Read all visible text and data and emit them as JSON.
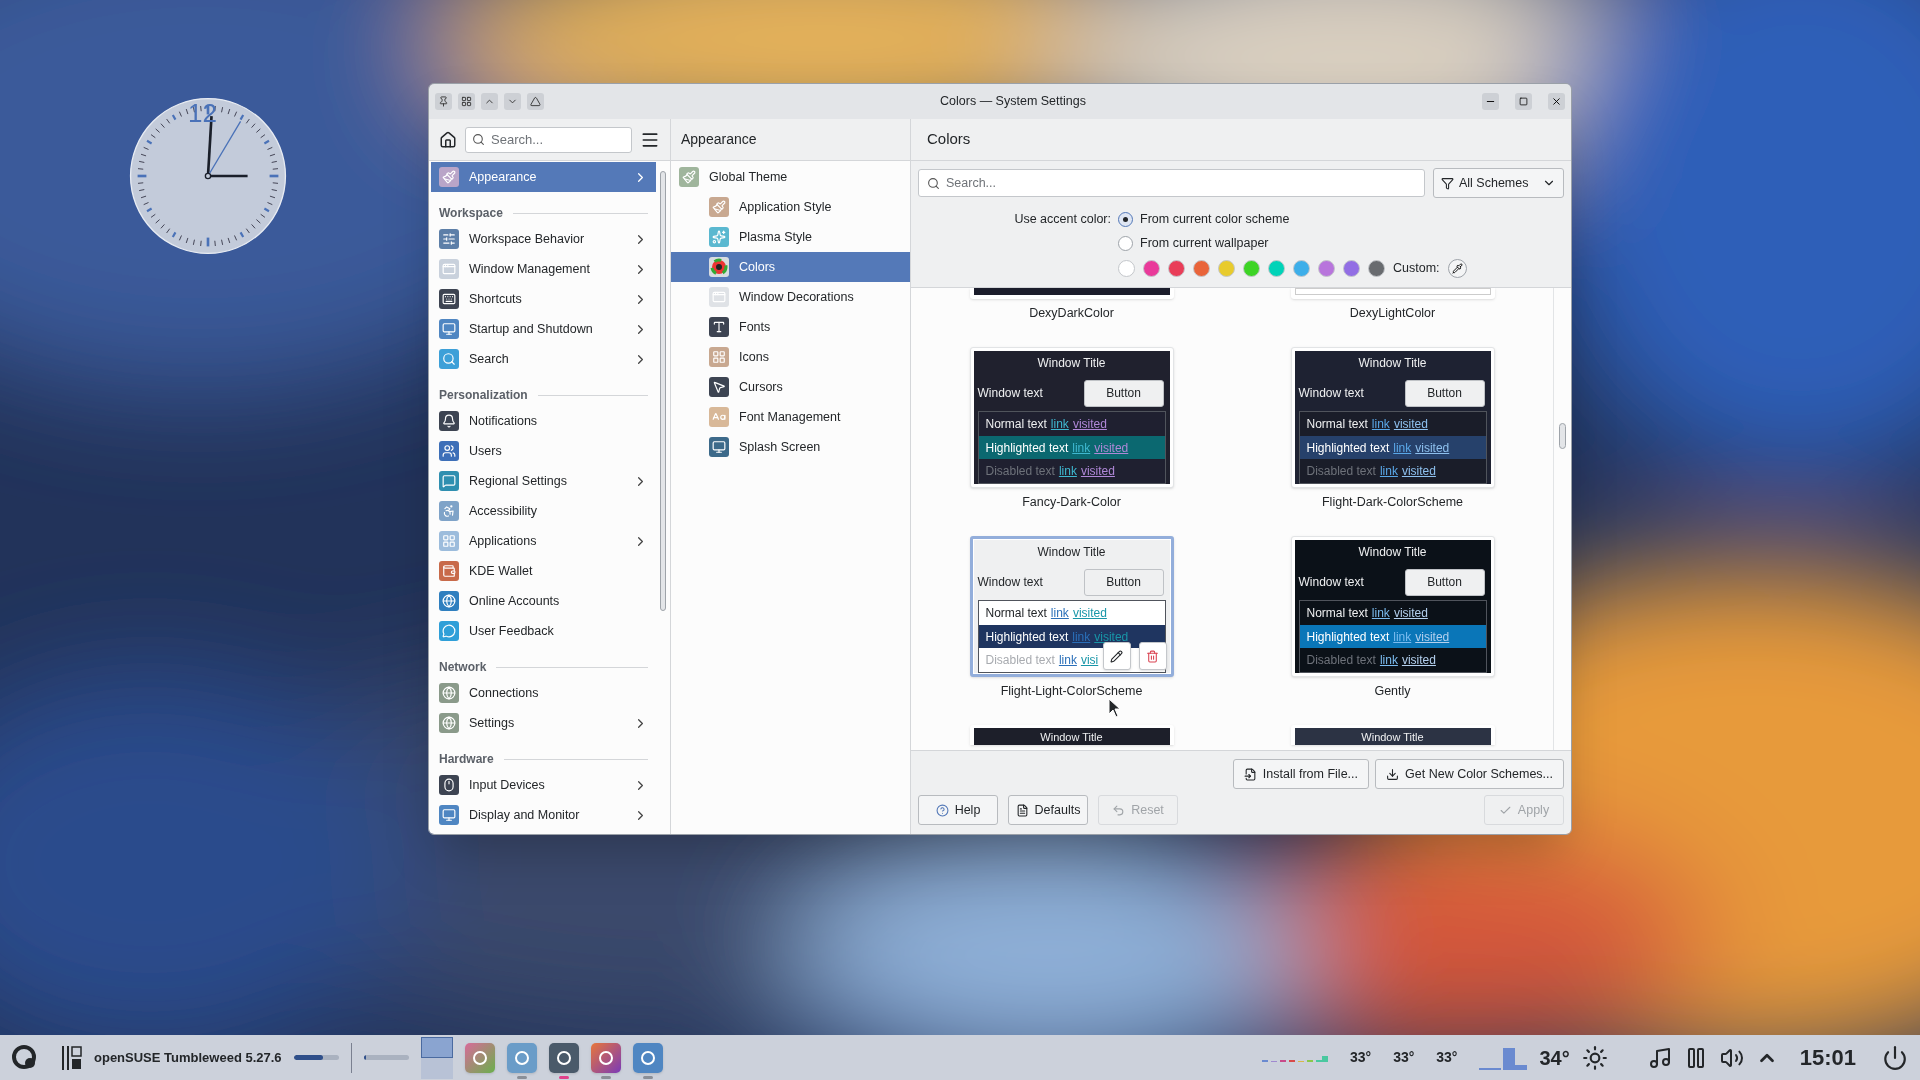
{
  "window": {
    "title": "Colors — System Settings"
  },
  "clock": {
    "numeral": "12"
  },
  "sidebar": {
    "search": {
      "placeholder": "Search..."
    },
    "items": [
      {
        "kind": "item",
        "label": "Appearance",
        "selected": true,
        "expandable": true
      },
      {
        "kind": "section",
        "label": "Workspace"
      },
      {
        "kind": "item",
        "label": "Workspace Behavior",
        "selected": false,
        "expandable": true
      },
      {
        "kind": "item",
        "label": "Window Management",
        "selected": false,
        "expandable": true
      },
      {
        "kind": "item",
        "label": "Shortcuts",
        "selected": false,
        "expandable": true
      },
      {
        "kind": "item",
        "label": "Startup and Shutdown",
        "selected": false,
        "expandable": true
      },
      {
        "kind": "item",
        "label": "Search",
        "selected": false,
        "expandable": true
      },
      {
        "kind": "section",
        "label": "Personalization"
      },
      {
        "kind": "item",
        "label": "Notifications",
        "selected": false,
        "expandable": false
      },
      {
        "kind": "item",
        "label": "Users",
        "selected": false,
        "expandable": false
      },
      {
        "kind": "item",
        "label": "Regional Settings",
        "selected": false,
        "expandable": true
      },
      {
        "kind": "item",
        "label": "Accessibility",
        "selected": false,
        "expandable": false
      },
      {
        "kind": "item",
        "label": "Applications",
        "selected": false,
        "expandable": true
      },
      {
        "kind": "item",
        "label": "KDE Wallet",
        "selected": false,
        "expandable": false
      },
      {
        "kind": "item",
        "label": "Online Accounts",
        "selected": false,
        "expandable": false
      },
      {
        "kind": "item",
        "label": "User Feedback",
        "selected": false,
        "expandable": false
      },
      {
        "kind": "section",
        "label": "Network"
      },
      {
        "kind": "item",
        "label": "Connections",
        "selected": false,
        "expandable": false
      },
      {
        "kind": "item",
        "label": "Settings",
        "selected": false,
        "expandable": true
      },
      {
        "kind": "section",
        "label": "Hardware"
      },
      {
        "kind": "item",
        "label": "Input Devices",
        "selected": false,
        "expandable": true
      },
      {
        "kind": "item",
        "label": "Display and Monitor",
        "selected": false,
        "expandable": true
      }
    ]
  },
  "subpanel": {
    "title": "Appearance",
    "items": [
      {
        "label": "Global Theme",
        "selected": false,
        "children": [
          {
            "label": "Application Style",
            "selected": false
          },
          {
            "label": "Plasma Style",
            "selected": false
          },
          {
            "label": "Colors",
            "selected": true
          },
          {
            "label": "Window Decorations",
            "selected": false
          },
          {
            "label": "Fonts",
            "selected": false
          },
          {
            "label": "Icons",
            "selected": false
          },
          {
            "label": "Cursors",
            "selected": false
          },
          {
            "label": "Font Management",
            "selected": false
          },
          {
            "label": "Splash Screen",
            "selected": false
          }
        ]
      }
    ]
  },
  "content": {
    "title": "Colors",
    "search": {
      "placeholder": "Search..."
    },
    "filter": "All Schemes",
    "accent": {
      "label": "Use accent color:",
      "options": [
        {
          "label": "From current color scheme",
          "selected": true
        },
        {
          "label": "From current wallpaper",
          "selected": false
        }
      ],
      "swatches": [
        {
          "color": "#ffffff"
        },
        {
          "color": "#e93a9a"
        },
        {
          "color": "#e93d58"
        },
        {
          "color": "#e9643a"
        },
        {
          "color": "#e8cb2d"
        },
        {
          "color": "#3dd425"
        },
        {
          "color": "#00d3b8"
        },
        {
          "color": "#3daee9"
        },
        {
          "color": "#b875dc"
        },
        {
          "color": "#926ee4"
        },
        {
          "color": "#686b6f"
        }
      ],
      "custom_label": "Custom:"
    },
    "schemes": [
      {
        "kind": "strip",
        "name": "DexyDarkColor",
        "selected": false,
        "dark": true,
        "color": "#1b1d2b"
      },
      {
        "kind": "strip",
        "name": "DexyLightColor",
        "selected": false,
        "dark": false,
        "color": "#ffffff"
      },
      {
        "kind": "full",
        "name": "Fancy-Dark-Color",
        "selected": false,
        "dark": true,
        "color": "#20212e",
        "palette": [
          {
            "kind": "view",
            "color": "#1f2030"
          },
          {
            "kind": "highlight",
            "color": "#0b6870"
          },
          {
            "kind": "link",
            "color": "#3fb8d0"
          },
          {
            "kind": "visited",
            "color": "#b088d8"
          }
        ],
        "preview": {
          "title": "Window Title",
          "window_text": "Window text",
          "button": "Button",
          "rows": [
            {
              "kind": "normal",
              "text": "Normal text",
              "link": "link",
              "visited": "visited"
            },
            {
              "kind": "highlighted",
              "text": "Highlighted text",
              "link": "link",
              "visited": "visited"
            },
            {
              "kind": "disabled",
              "text": "Disabled text",
              "link": "link",
              "visited": "visited"
            }
          ]
        }
      },
      {
        "kind": "full",
        "name": "Flight-Dark-ColorScheme",
        "selected": false,
        "dark": true,
        "color": "#1e2232",
        "palette": [
          {
            "kind": "view",
            "color": "#1a1d29"
          },
          {
            "kind": "highlight",
            "color": "#26416b"
          },
          {
            "kind": "link",
            "color": "#5aa8e8"
          },
          {
            "kind": "visited",
            "color": "#8ec0ee"
          }
        ],
        "preview": {
          "title": "Window Title",
          "window_text": "Window text",
          "button": "Button",
          "rows": [
            {
              "kind": "normal",
              "text": "Normal text",
              "link": "link",
              "visited": "visited"
            },
            {
              "kind": "highlighted",
              "text": "Highlighted text",
              "link": "link",
              "visited": "visited"
            },
            {
              "kind": "disabled",
              "text": "Disabled text",
              "link": "link",
              "visited": "visited"
            }
          ]
        }
      },
      {
        "kind": "full",
        "name": "Flight-Light-ColorScheme",
        "selected": true,
        "dark": false,
        "color": "#eff0f1",
        "palette": [
          {
            "kind": "view",
            "color": "#ffffff"
          },
          {
            "kind": "highlight",
            "color": "#1f3560"
          },
          {
            "kind": "link",
            "color": "#2a6fb9"
          },
          {
            "kind": "visited",
            "color": "#1896a8"
          }
        ],
        "preview": {
          "title": "Window Title",
          "window_text": "Window text",
          "button": "Button",
          "rows": [
            {
              "kind": "normal",
              "text": "Normal text",
              "link": "link",
              "visited": "visited"
            },
            {
              "kind": "highlighted",
              "text": "Highlighted text",
              "link": "link",
              "visited": "visited"
            },
            {
              "kind": "disabled",
              "text": "Disabled text",
              "link": "link",
              "visited": "visi"
            }
          ]
        }
      },
      {
        "kind": "full",
        "name": "Gently",
        "selected": false,
        "dark": true,
        "color": "#0b1118",
        "palette": [
          {
            "kind": "view",
            "color": "#0b1118"
          },
          {
            "kind": "highlight",
            "color": "#0a76b8"
          },
          {
            "kind": "link",
            "color": "#7cbcf0"
          },
          {
            "kind": "visited",
            "color": "#b4d0ee"
          }
        ],
        "preview": {
          "title": "Window Title",
          "window_text": "Window text",
          "button": "Button",
          "rows": [
            {
              "kind": "normal",
              "text": "Normal text",
              "link": "link",
              "visited": "visited"
            },
            {
              "kind": "highlighted",
              "text": "Highlighted text",
              "link": "link",
              "visited": "visited"
            },
            {
              "kind": "disabled",
              "text": "Disabled text",
              "link": "link",
              "visited": "visited"
            }
          ]
        }
      },
      {
        "kind": "title_only",
        "selected": false,
        "dark": true,
        "color": "#1d1f2a",
        "preview": {
          "title": "Window Title"
        }
      },
      {
        "kind": "title_only",
        "selected": false,
        "dark": true,
        "color": "#2c3344",
        "preview": {
          "title": "Window Title"
        }
      }
    ],
    "actions": [
      "Install from File...",
      "Get New Color Schemes..."
    ],
    "footer": [
      {
        "label": "Help",
        "disabled": false
      },
      {
        "label": "Defaults",
        "disabled": false
      },
      {
        "label": "Reset",
        "disabled": true
      },
      {
        "label": "Apply",
        "disabled": true
      }
    ]
  },
  "taskbar": {
    "title": "openSUSE Tumbleweed 5.27.6",
    "meters": [
      {
        "level": 0.65
      },
      {
        "level": 0.05
      }
    ],
    "desktops": [
      {
        "selected": true
      },
      {
        "selected": false
      }
    ],
    "apps": [
      {
        "kind": "idle"
      },
      {
        "kind": "running"
      },
      {
        "kind": "active"
      },
      {
        "kind": "running"
      },
      {
        "kind": "running"
      }
    ],
    "temps": [
      "33°",
      "33°",
      "33°"
    ],
    "weather": "34°",
    "time": "15:01"
  }
}
